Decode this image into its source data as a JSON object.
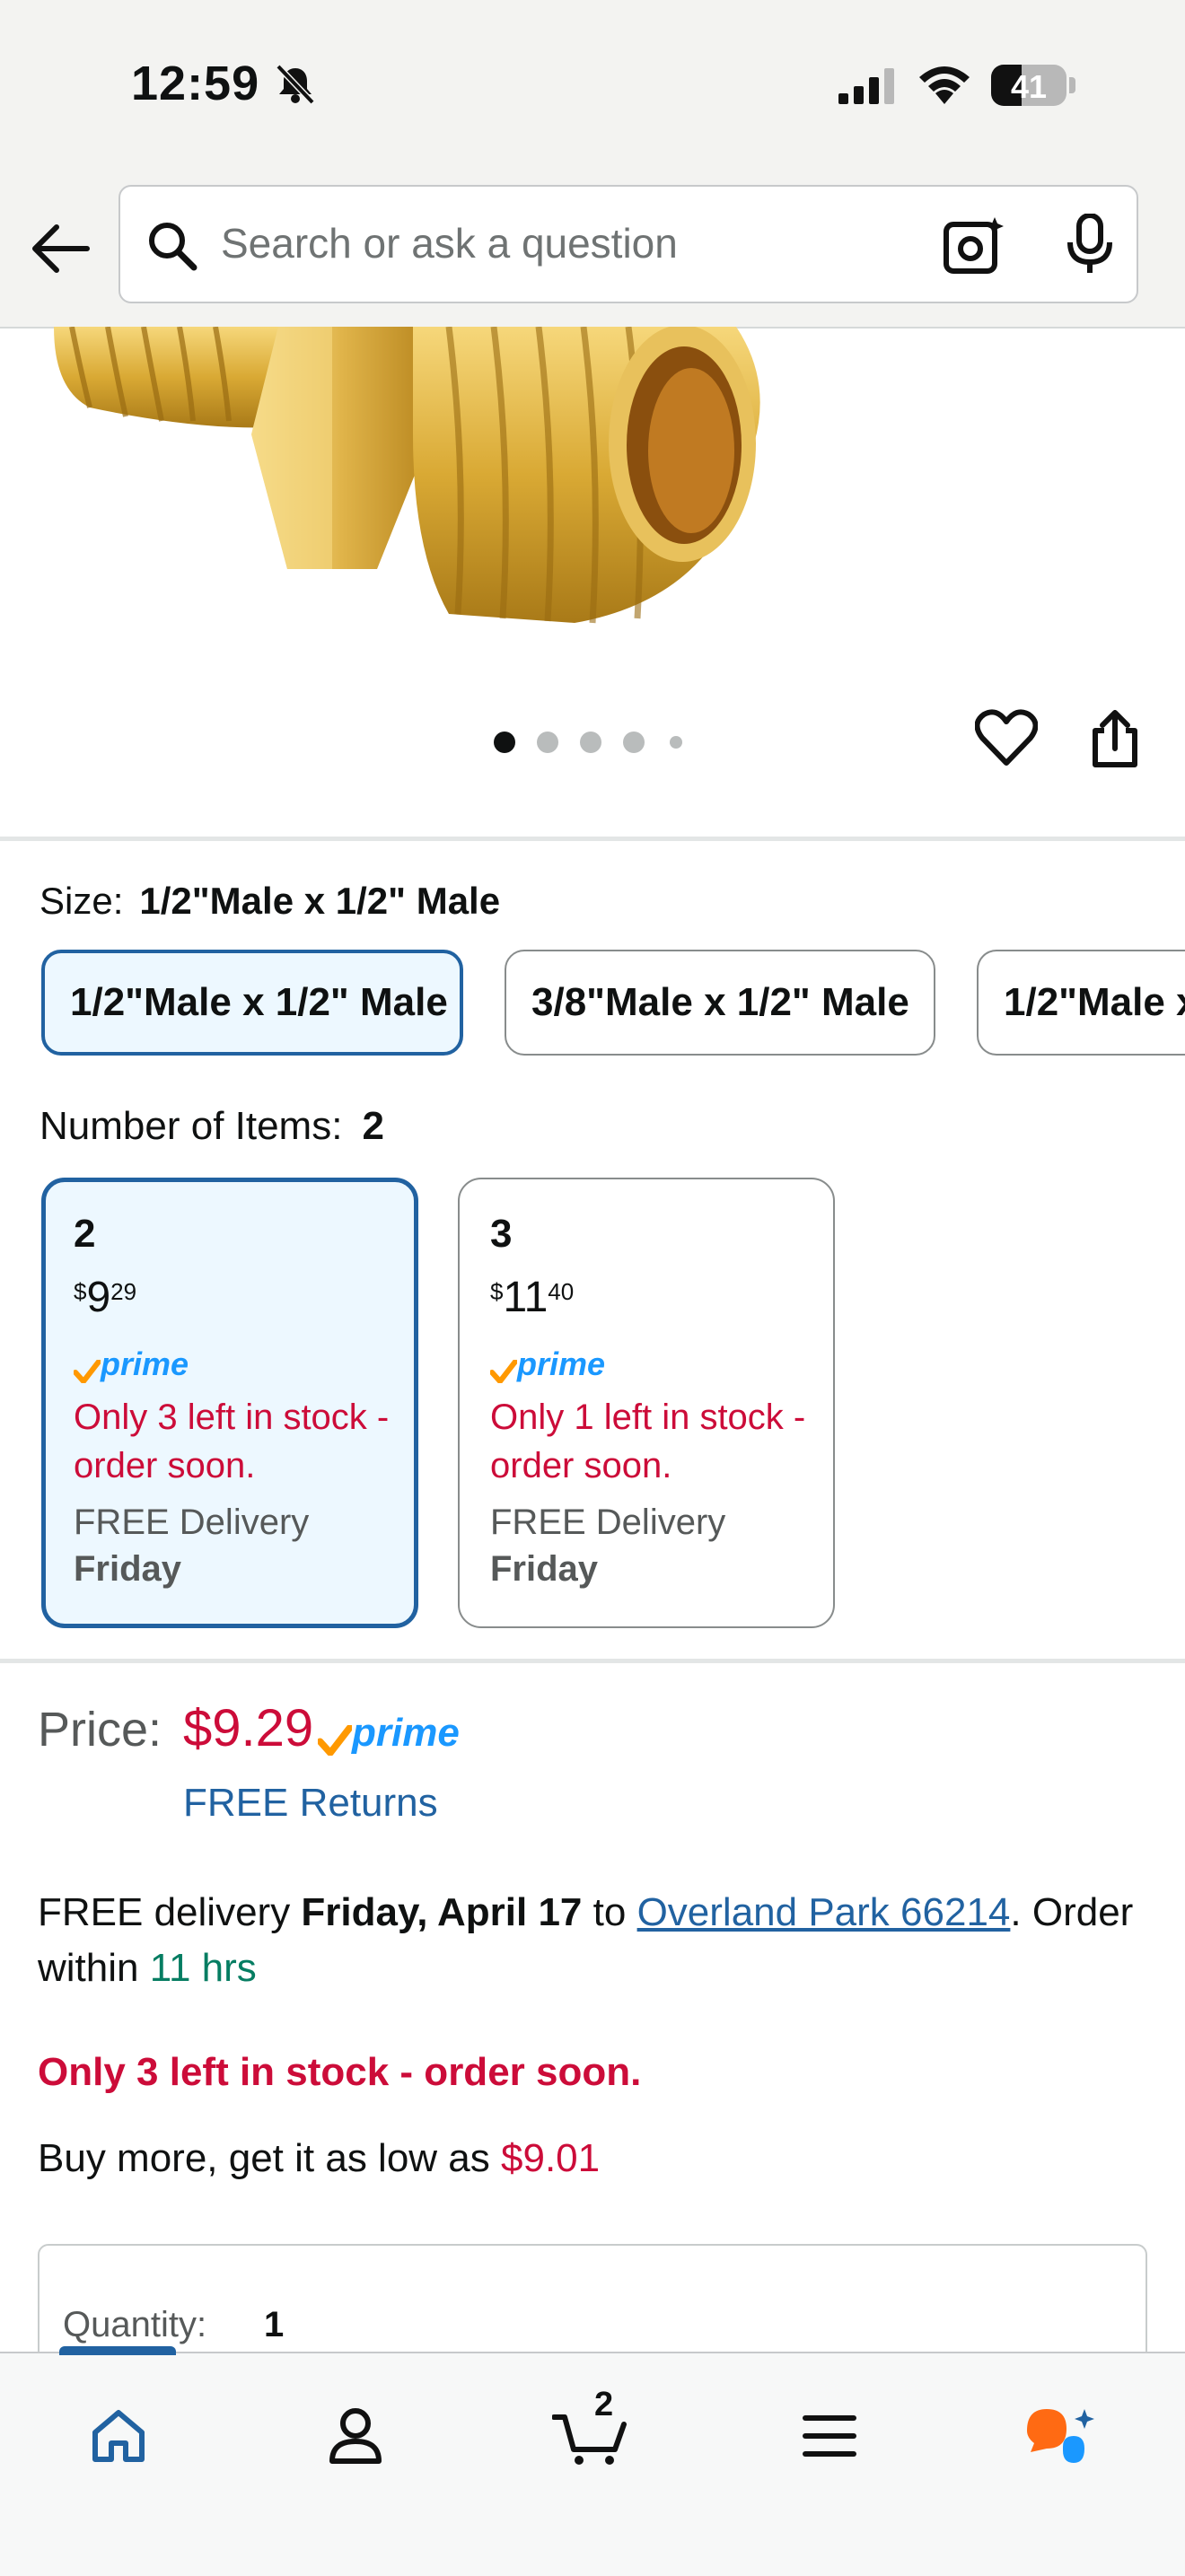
{
  "status_bar": {
    "time": "12:59",
    "battery": "41",
    "battery_level": 0.41
  },
  "search": {
    "placeholder": "Search or ask a question"
  },
  "gallery": {
    "dot_count": 5,
    "active_dot": 0
  },
  "size": {
    "label": "Size:",
    "selected": "1/2\"Male x 1/2\" Male",
    "options": [
      "1/2\"Male x 1/2\" Male",
      "3/8\"Male x 1/2\" Male",
      "1/2\"Male x"
    ]
  },
  "items": {
    "label": "Number of Items:",
    "selected": "2",
    "options": [
      {
        "count": "2",
        "dollar": "$",
        "whole": "9",
        "cents": "29",
        "prime": "prime",
        "stock": "Only 3 left in stock - order soon.",
        "delivery": "FREE Delivery",
        "day": "Friday"
      },
      {
        "count": "3",
        "dollar": "$",
        "whole": "11",
        "cents": "40",
        "prime": "prime",
        "stock": "Only 1 left in stock - order soon.",
        "delivery": "FREE Delivery",
        "day": "Friday"
      }
    ]
  },
  "price": {
    "label": "Price:",
    "value": "$9.29",
    "prime": "prime",
    "returns": "FREE Returns"
  },
  "delivery": {
    "prefix": "FREE delivery",
    "date": "Friday, April 17",
    "to": "to",
    "location": "Overland Park 66214",
    "order_within": ". Order within",
    "time_left": "11 hrs"
  },
  "stock_warning": "Only 3 left in stock - order soon.",
  "buy_more": {
    "text": "Buy more, get it as low as",
    "price": "$9.01"
  },
  "quantity": {
    "label": "Quantity:",
    "value": "1"
  },
  "bottom_nav": {
    "cart_count": "2",
    "items": [
      "home",
      "account",
      "cart",
      "menu",
      "rufus"
    ]
  },
  "colors": {
    "accent_blue": "#2162a1",
    "price_red": "#cc0c39",
    "prime_blue": "#1a98ff",
    "prime_check": "#ff9900",
    "green": "#067d62"
  }
}
